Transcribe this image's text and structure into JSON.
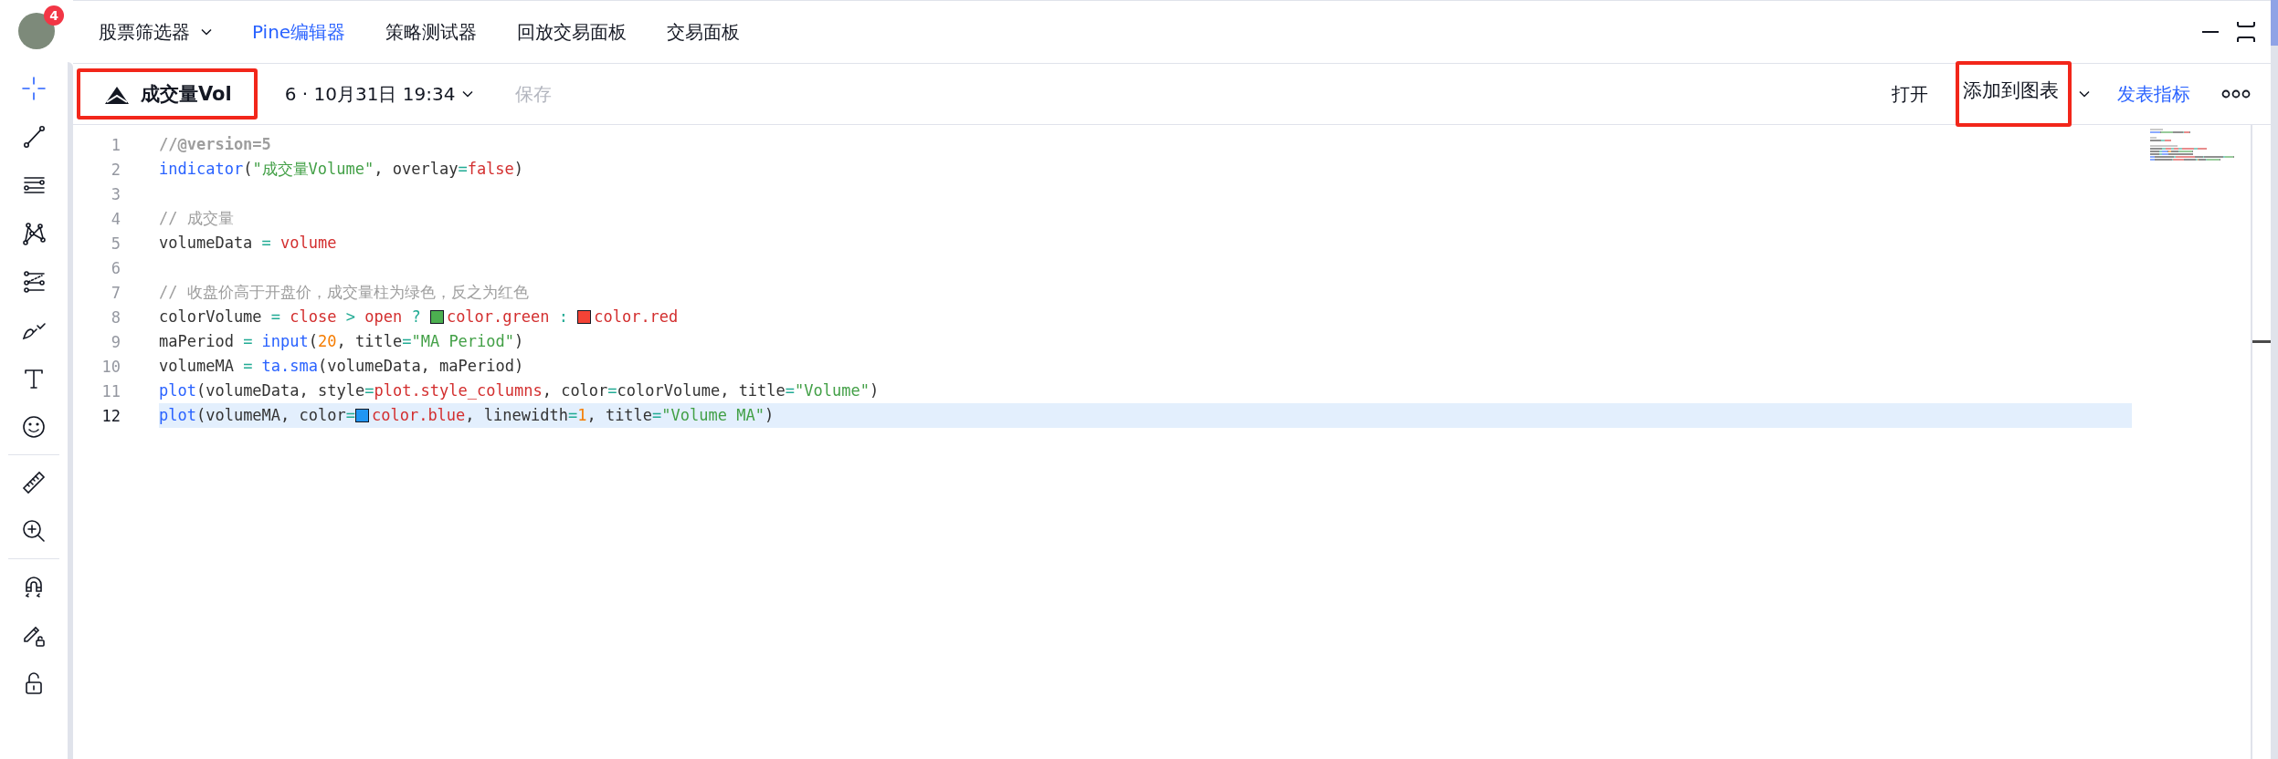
{
  "account": {
    "badge": "4"
  },
  "tools": [
    {
      "kind": "crosshair",
      "selected": true
    },
    {
      "kind": "trendline",
      "selected": false
    },
    {
      "kind": "hlines",
      "selected": false
    },
    {
      "kind": "pattern",
      "selected": false
    },
    {
      "kind": "fib",
      "selected": false
    },
    {
      "kind": "brush",
      "selected": false
    },
    {
      "kind": "text",
      "selected": false
    },
    {
      "kind": "emoji",
      "selected": false
    },
    {
      "kind": "divider"
    },
    {
      "kind": "ruler",
      "selected": false
    },
    {
      "kind": "zoom",
      "selected": false
    },
    {
      "kind": "divider"
    },
    {
      "kind": "magnet",
      "selected": false
    },
    {
      "kind": "drawlock",
      "selected": false
    },
    {
      "kind": "lock",
      "selected": false
    }
  ],
  "tabs": [
    {
      "label": "股票筛选器",
      "dropdown": true,
      "selected": false
    },
    {
      "label": "Pine编辑器",
      "dropdown": false,
      "selected": true
    },
    {
      "label": "策略测试器",
      "dropdown": false,
      "selected": false
    },
    {
      "label": "回放交易面板",
      "dropdown": false,
      "selected": false
    },
    {
      "label": "交易面板",
      "dropdown": false,
      "selected": false
    }
  ],
  "editor_toolbar": {
    "script_name": "成交量Vol",
    "script_highlighted": true,
    "version": "6 · 10月31日 19:34",
    "save": {
      "label": "保存",
      "disabled": true
    },
    "actions": [
      {
        "label": "打开",
        "kind": "plain",
        "highlighted": false
      },
      {
        "label": "添加到图表",
        "kind": "dropdown",
        "highlighted": true
      },
      {
        "label": "发表指标",
        "kind": "link",
        "highlighted": false
      }
    ]
  },
  "code_lines": [
    {
      "number": "1",
      "selected": false,
      "tokens": [
        {
          "kind": "annotation",
          "text": "//@version=5"
        }
      ]
    },
    {
      "number": "2",
      "selected": false,
      "tokens": [
        {
          "kind": "fn",
          "text": "indicator"
        },
        {
          "kind": "plain",
          "text": "("
        },
        {
          "kind": "str",
          "text": "\"成交量Volume\""
        },
        {
          "kind": "plain",
          "text": ", overlay"
        },
        {
          "kind": "op",
          "text": "="
        },
        {
          "kind": "const",
          "text": "false"
        },
        {
          "kind": "plain",
          "text": ")"
        }
      ]
    },
    {
      "number": "3",
      "selected": false
    },
    {
      "number": "4",
      "selected": false,
      "tokens": [
        {
          "kind": "comment",
          "text": "// 成交量"
        }
      ]
    },
    {
      "number": "5",
      "selected": false,
      "tokens": [
        {
          "kind": "plain",
          "text": "volumeData"
        },
        {
          "kind": "op",
          "text": " = "
        },
        {
          "kind": "const",
          "text": "volume"
        }
      ]
    },
    {
      "number": "6",
      "selected": false
    },
    {
      "number": "7",
      "selected": false,
      "tokens": [
        {
          "kind": "comment",
          "text": "// 收盘价高于开盘价，成交量柱为绿色，反之为红色"
        }
      ]
    },
    {
      "number": "8",
      "selected": false,
      "tokens": [
        {
          "kind": "plain",
          "text": "colorVolume"
        },
        {
          "kind": "op",
          "text": " = "
        },
        {
          "kind": "const",
          "text": "close"
        },
        {
          "kind": "op",
          "text": " > "
        },
        {
          "kind": "const",
          "text": "open"
        },
        {
          "kind": "op",
          "text": " ? "
        },
        {
          "kind": "swatch",
          "color": "#4caf50"
        },
        {
          "kind": "const",
          "text": "color.green"
        },
        {
          "kind": "op",
          "text": " : "
        },
        {
          "kind": "swatch",
          "color": "#f44336"
        },
        {
          "kind": "const",
          "text": "color.red"
        }
      ]
    },
    {
      "number": "9",
      "selected": false,
      "tokens": [
        {
          "kind": "plain",
          "text": "maPeriod"
        },
        {
          "kind": "op",
          "text": " = "
        },
        {
          "kind": "fn",
          "text": "input"
        },
        {
          "kind": "plain",
          "text": "("
        },
        {
          "kind": "num",
          "text": "20"
        },
        {
          "kind": "plain",
          "text": ", title"
        },
        {
          "kind": "op",
          "text": "="
        },
        {
          "kind": "str",
          "text": "\"MA Period\""
        },
        {
          "kind": "plain",
          "text": ")"
        }
      ]
    },
    {
      "number": "10",
      "selected": false,
      "tokens": [
        {
          "kind": "plain",
          "text": "volumeMA"
        },
        {
          "kind": "op",
          "text": " = "
        },
        {
          "kind": "fn",
          "text": "ta.sma"
        },
        {
          "kind": "plain",
          "text": "(volumeData, maPeriod)"
        }
      ]
    },
    {
      "number": "11",
      "selected": false,
      "tokens": [
        {
          "kind": "fn",
          "text": "plot"
        },
        {
          "kind": "plain",
          "text": "(volumeData, style"
        },
        {
          "kind": "op",
          "text": "="
        },
        {
          "kind": "const",
          "text": "plot.style_columns"
        },
        {
          "kind": "plain",
          "text": ", color"
        },
        {
          "kind": "op",
          "text": "="
        },
        {
          "kind": "plain",
          "text": "colorVolume, title"
        },
        {
          "kind": "op",
          "text": "="
        },
        {
          "kind": "str",
          "text": "\"Volume\""
        },
        {
          "kind": "plain",
          "text": ")"
        }
      ]
    },
    {
      "number": "12",
      "selected": true,
      "tokens": [
        {
          "kind": "fn",
          "text": "plot"
        },
        {
          "kind": "plain",
          "text": "(volumeMA, color"
        },
        {
          "kind": "op",
          "text": "="
        },
        {
          "kind": "swatch",
          "color": "#2196f3"
        },
        {
          "kind": "const",
          "text": "color.blue"
        },
        {
          "kind": "plain",
          "text": ", linewidth"
        },
        {
          "kind": "op",
          "text": "="
        },
        {
          "kind": "num",
          "text": "1"
        },
        {
          "kind": "plain",
          "text": ", title"
        },
        {
          "kind": "op",
          "text": "="
        },
        {
          "kind": "str",
          "text": "\"Volume MA\""
        },
        {
          "kind": "plain",
          "text": ")"
        }
      ]
    }
  ]
}
